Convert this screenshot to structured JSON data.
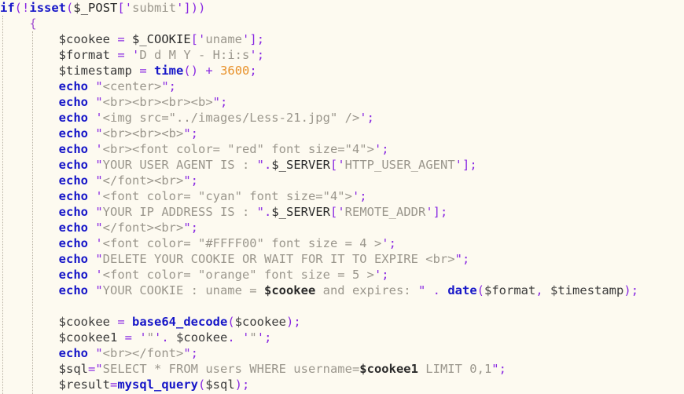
{
  "editor": {
    "language": "PHP",
    "background_color": "#FDFAF0",
    "indent_guide_color": "#b9b2a4",
    "theme_colors": {
      "keyword": "#1616c8",
      "function": "#1616c8",
      "punctuation": "#8a2be2",
      "variable": "#3a3a3a",
      "superglobal": "#2a2a2a",
      "string": "#9a968c",
      "quote": "#8a2be2",
      "number": "#e8912a",
      "brace": "#a24fd0"
    }
  },
  "lines": [
    {
      "id": 1,
      "text": "if(!isset($_POST['submit']))",
      "tokens": [
        {
          "t": "if",
          "c": "kw"
        },
        {
          "t": "(",
          "c": "punc"
        },
        {
          "t": "!",
          "c": "punc"
        },
        {
          "t": "isset",
          "c": "fn"
        },
        {
          "t": "(",
          "c": "punc"
        },
        {
          "t": "$_POST",
          "c": "super"
        },
        {
          "t": "[",
          "c": "punc"
        },
        {
          "t": "'",
          "c": "quote"
        },
        {
          "t": "submit",
          "c": "str"
        },
        {
          "t": "'",
          "c": "quote"
        },
        {
          "t": "]",
          "c": "punc"
        },
        {
          "t": ")",
          "c": "punc"
        },
        {
          "t": ")",
          "c": "punc"
        }
      ]
    },
    {
      "id": 2,
      "text": "    {",
      "tokens": [
        {
          "t": "    ",
          "c": "plain"
        },
        {
          "t": "{",
          "c": "brace"
        }
      ]
    },
    {
      "id": 3,
      "text": "        $cookee = $_COOKIE['uname'];",
      "tokens": [
        {
          "t": "        ",
          "c": "plain"
        },
        {
          "t": "$cookee",
          "c": "var"
        },
        {
          "t": " ",
          "c": "plain"
        },
        {
          "t": "=",
          "c": "punc"
        },
        {
          "t": " ",
          "c": "plain"
        },
        {
          "t": "$_COOKIE",
          "c": "super"
        },
        {
          "t": "[",
          "c": "punc"
        },
        {
          "t": "'",
          "c": "quote"
        },
        {
          "t": "uname",
          "c": "str"
        },
        {
          "t": "'",
          "c": "quote"
        },
        {
          "t": "]",
          "c": "punc"
        },
        {
          "t": ";",
          "c": "punc"
        }
      ]
    },
    {
      "id": 4,
      "text": "        $format = 'D d M Y - H:i:s';",
      "tokens": [
        {
          "t": "        ",
          "c": "plain"
        },
        {
          "t": "$format",
          "c": "var"
        },
        {
          "t": " ",
          "c": "plain"
        },
        {
          "t": "=",
          "c": "punc"
        },
        {
          "t": " ",
          "c": "plain"
        },
        {
          "t": "'",
          "c": "quote"
        },
        {
          "t": "D d M Y - H:i:s",
          "c": "str"
        },
        {
          "t": "'",
          "c": "quote"
        },
        {
          "t": ";",
          "c": "punc"
        }
      ]
    },
    {
      "id": 5,
      "text": "        $timestamp = time() + 3600;",
      "tokens": [
        {
          "t": "        ",
          "c": "plain"
        },
        {
          "t": "$timestamp",
          "c": "var"
        },
        {
          "t": " ",
          "c": "plain"
        },
        {
          "t": "=",
          "c": "punc"
        },
        {
          "t": " ",
          "c": "plain"
        },
        {
          "t": "time",
          "c": "fn"
        },
        {
          "t": "(",
          "c": "punc"
        },
        {
          "t": ")",
          "c": "punc"
        },
        {
          "t": " ",
          "c": "plain"
        },
        {
          "t": "+",
          "c": "punc"
        },
        {
          "t": " ",
          "c": "plain"
        },
        {
          "t": "3600",
          "c": "num"
        },
        {
          "t": ";",
          "c": "punc"
        }
      ]
    },
    {
      "id": 6,
      "text": "        echo \"<center>\";",
      "tokens": [
        {
          "t": "        ",
          "c": "plain"
        },
        {
          "t": "echo",
          "c": "kw"
        },
        {
          "t": " ",
          "c": "plain"
        },
        {
          "t": "\"",
          "c": "quote"
        },
        {
          "t": "<center>",
          "c": "str"
        },
        {
          "t": "\"",
          "c": "quote"
        },
        {
          "t": ";",
          "c": "punc"
        }
      ]
    },
    {
      "id": 7,
      "text": "        echo \"<br><br><br><b>\";",
      "tokens": [
        {
          "t": "        ",
          "c": "plain"
        },
        {
          "t": "echo",
          "c": "kw"
        },
        {
          "t": " ",
          "c": "plain"
        },
        {
          "t": "\"",
          "c": "quote"
        },
        {
          "t": "<br><br><br><b>",
          "c": "str"
        },
        {
          "t": "\"",
          "c": "quote"
        },
        {
          "t": ";",
          "c": "punc"
        }
      ]
    },
    {
      "id": 8,
      "text": "        echo '<img src=\"../images/Less-21.jpg\" />';",
      "tokens": [
        {
          "t": "        ",
          "c": "plain"
        },
        {
          "t": "echo",
          "c": "kw"
        },
        {
          "t": " ",
          "c": "plain"
        },
        {
          "t": "'",
          "c": "quote"
        },
        {
          "t": "<img src=\"../images/Less-21.jpg\" />",
          "c": "str"
        },
        {
          "t": "'",
          "c": "quote"
        },
        {
          "t": ";",
          "c": "punc"
        }
      ]
    },
    {
      "id": 9,
      "text": "        echo \"<br><br><b>\";",
      "tokens": [
        {
          "t": "        ",
          "c": "plain"
        },
        {
          "t": "echo",
          "c": "kw"
        },
        {
          "t": " ",
          "c": "plain"
        },
        {
          "t": "\"",
          "c": "quote"
        },
        {
          "t": "<br><br><b>",
          "c": "str"
        },
        {
          "t": "\"",
          "c": "quote"
        },
        {
          "t": ";",
          "c": "punc"
        }
      ]
    },
    {
      "id": 10,
      "text": "        echo '<br><font color= \"red\" font size=\"4\">';",
      "tokens": [
        {
          "t": "        ",
          "c": "plain"
        },
        {
          "t": "echo",
          "c": "kw"
        },
        {
          "t": " ",
          "c": "plain"
        },
        {
          "t": "'",
          "c": "quote"
        },
        {
          "t": "<br><font color= \"red\" font size=\"4\">",
          "c": "str"
        },
        {
          "t": "'",
          "c": "quote"
        },
        {
          "t": ";",
          "c": "punc"
        }
      ]
    },
    {
      "id": 11,
      "text": "        echo \"YOUR USER AGENT IS : \".$_SERVER['HTTP_USER_AGENT'];",
      "tokens": [
        {
          "t": "        ",
          "c": "plain"
        },
        {
          "t": "echo",
          "c": "kw"
        },
        {
          "t": " ",
          "c": "plain"
        },
        {
          "t": "\"",
          "c": "quote"
        },
        {
          "t": "YOUR USER AGENT IS : ",
          "c": "str"
        },
        {
          "t": "\"",
          "c": "quote"
        },
        {
          "t": ".",
          "c": "punc"
        },
        {
          "t": "$_SERVER",
          "c": "super"
        },
        {
          "t": "[",
          "c": "punc"
        },
        {
          "t": "'",
          "c": "quote"
        },
        {
          "t": "HTTP_USER_AGENT",
          "c": "str"
        },
        {
          "t": "'",
          "c": "quote"
        },
        {
          "t": "]",
          "c": "punc"
        },
        {
          "t": ";",
          "c": "punc"
        }
      ]
    },
    {
      "id": 12,
      "text": "        echo \"</font><br>\";",
      "tokens": [
        {
          "t": "        ",
          "c": "plain"
        },
        {
          "t": "echo",
          "c": "kw"
        },
        {
          "t": " ",
          "c": "plain"
        },
        {
          "t": "\"",
          "c": "quote"
        },
        {
          "t": "</font><br>",
          "c": "str"
        },
        {
          "t": "\"",
          "c": "quote"
        },
        {
          "t": ";",
          "c": "punc"
        }
      ]
    },
    {
      "id": 13,
      "text": "        echo '<font color= \"cyan\" font size=\"4\">';",
      "tokens": [
        {
          "t": "        ",
          "c": "plain"
        },
        {
          "t": "echo",
          "c": "kw"
        },
        {
          "t": " ",
          "c": "plain"
        },
        {
          "t": "'",
          "c": "quote"
        },
        {
          "t": "<font color= \"cyan\" font size=\"4\">",
          "c": "str"
        },
        {
          "t": "'",
          "c": "quote"
        },
        {
          "t": ";",
          "c": "punc"
        }
      ]
    },
    {
      "id": 14,
      "text": "        echo \"YOUR IP ADDRESS IS : \".$_SERVER['REMOTE_ADDR'];",
      "tokens": [
        {
          "t": "        ",
          "c": "plain"
        },
        {
          "t": "echo",
          "c": "kw"
        },
        {
          "t": " ",
          "c": "plain"
        },
        {
          "t": "\"",
          "c": "quote"
        },
        {
          "t": "YOUR IP ADDRESS IS : ",
          "c": "str"
        },
        {
          "t": "\"",
          "c": "quote"
        },
        {
          "t": ".",
          "c": "punc"
        },
        {
          "t": "$_SERVER",
          "c": "super"
        },
        {
          "t": "[",
          "c": "punc"
        },
        {
          "t": "'",
          "c": "quote"
        },
        {
          "t": "REMOTE_ADDR",
          "c": "str"
        },
        {
          "t": "'",
          "c": "quote"
        },
        {
          "t": "]",
          "c": "punc"
        },
        {
          "t": ";",
          "c": "punc"
        }
      ]
    },
    {
      "id": 15,
      "text": "        echo \"</font><br>\";",
      "tokens": [
        {
          "t": "        ",
          "c": "plain"
        },
        {
          "t": "echo",
          "c": "kw"
        },
        {
          "t": " ",
          "c": "plain"
        },
        {
          "t": "\"",
          "c": "quote"
        },
        {
          "t": "</font><br>",
          "c": "str"
        },
        {
          "t": "\"",
          "c": "quote"
        },
        {
          "t": ";",
          "c": "punc"
        }
      ]
    },
    {
      "id": 16,
      "text": "        echo '<font color= \"#FFFF00\" font size = 4 >';",
      "tokens": [
        {
          "t": "        ",
          "c": "plain"
        },
        {
          "t": "echo",
          "c": "kw"
        },
        {
          "t": " ",
          "c": "plain"
        },
        {
          "t": "'",
          "c": "quote"
        },
        {
          "t": "<font color= \"#FFFF00\" font size = 4 >",
          "c": "str"
        },
        {
          "t": "'",
          "c": "quote"
        },
        {
          "t": ";",
          "c": "punc"
        }
      ]
    },
    {
      "id": 17,
      "text": "        echo \"DELETE YOUR COOKIE OR WAIT FOR IT TO EXPIRE <br>\";",
      "tokens": [
        {
          "t": "        ",
          "c": "plain"
        },
        {
          "t": "echo",
          "c": "kw"
        },
        {
          "t": " ",
          "c": "plain"
        },
        {
          "t": "\"",
          "c": "quote"
        },
        {
          "t": "DELETE YOUR COOKIE OR WAIT FOR IT TO EXPIRE <br>",
          "c": "str"
        },
        {
          "t": "\"",
          "c": "quote"
        },
        {
          "t": ";",
          "c": "punc"
        }
      ]
    },
    {
      "id": 18,
      "text": "        echo '<font color= \"orange\" font size = 5 >';",
      "tokens": [
        {
          "t": "        ",
          "c": "plain"
        },
        {
          "t": "echo",
          "c": "kw"
        },
        {
          "t": " ",
          "c": "plain"
        },
        {
          "t": "'",
          "c": "quote"
        },
        {
          "t": "<font color= \"orange\" font size = 5 >",
          "c": "str"
        },
        {
          "t": "'",
          "c": "quote"
        },
        {
          "t": ";",
          "c": "punc"
        }
      ]
    },
    {
      "id": 19,
      "text": "        echo \"YOUR COOKIE : uname = $cookee and expires: \" . date($format, $timestamp);",
      "tokens": [
        {
          "t": "        ",
          "c": "plain"
        },
        {
          "t": "echo",
          "c": "kw"
        },
        {
          "t": " ",
          "c": "plain"
        },
        {
          "t": "\"",
          "c": "quote"
        },
        {
          "t": "YOUR COOKIE : uname = ",
          "c": "str"
        },
        {
          "t": "$cookee",
          "c": "interp"
        },
        {
          "t": " and expires: ",
          "c": "str"
        },
        {
          "t": "\"",
          "c": "quote"
        },
        {
          "t": " ",
          "c": "plain"
        },
        {
          "t": ".",
          "c": "punc"
        },
        {
          "t": " ",
          "c": "plain"
        },
        {
          "t": "date",
          "c": "fn"
        },
        {
          "t": "(",
          "c": "punc"
        },
        {
          "t": "$format",
          "c": "var"
        },
        {
          "t": ",",
          "c": "punc"
        },
        {
          "t": " ",
          "c": "plain"
        },
        {
          "t": "$timestamp",
          "c": "var"
        },
        {
          "t": ")",
          "c": "punc"
        },
        {
          "t": ";",
          "c": "punc"
        }
      ]
    },
    {
      "id": 20,
      "text": "",
      "tokens": []
    },
    {
      "id": 21,
      "text": "        $cookee = base64_decode($cookee);",
      "tokens": [
        {
          "t": "        ",
          "c": "plain"
        },
        {
          "t": "$cookee",
          "c": "var"
        },
        {
          "t": " ",
          "c": "plain"
        },
        {
          "t": "=",
          "c": "punc"
        },
        {
          "t": " ",
          "c": "plain"
        },
        {
          "t": "base64_decode",
          "c": "fn"
        },
        {
          "t": "(",
          "c": "punc"
        },
        {
          "t": "$cookee",
          "c": "var"
        },
        {
          "t": ")",
          "c": "punc"
        },
        {
          "t": ";",
          "c": "punc"
        }
      ]
    },
    {
      "id": 22,
      "text": "        $cookee1 = '\"'. $cookee. '\"';",
      "tokens": [
        {
          "t": "        ",
          "c": "plain"
        },
        {
          "t": "$cookee1",
          "c": "var"
        },
        {
          "t": " ",
          "c": "plain"
        },
        {
          "t": "=",
          "c": "punc"
        },
        {
          "t": " ",
          "c": "plain"
        },
        {
          "t": "'",
          "c": "quote"
        },
        {
          "t": "\"",
          "c": "str"
        },
        {
          "t": "'",
          "c": "quote"
        },
        {
          "t": ".",
          "c": "punc"
        },
        {
          "t": " ",
          "c": "plain"
        },
        {
          "t": "$cookee",
          "c": "var"
        },
        {
          "t": ".",
          "c": "punc"
        },
        {
          "t": " ",
          "c": "plain"
        },
        {
          "t": "'",
          "c": "quote"
        },
        {
          "t": "\"",
          "c": "str"
        },
        {
          "t": "'",
          "c": "quote"
        },
        {
          "t": ";",
          "c": "punc"
        }
      ]
    },
    {
      "id": 23,
      "text": "        echo \"<br></font>\";",
      "tokens": [
        {
          "t": "        ",
          "c": "plain"
        },
        {
          "t": "echo",
          "c": "kw"
        },
        {
          "t": " ",
          "c": "plain"
        },
        {
          "t": "\"",
          "c": "quote"
        },
        {
          "t": "<br></font>",
          "c": "str"
        },
        {
          "t": "\"",
          "c": "quote"
        },
        {
          "t": ";",
          "c": "punc"
        }
      ]
    },
    {
      "id": 24,
      "text": "        $sql=\"SELECT * FROM users WHERE username=$cookee1 LIMIT 0,1\";",
      "tokens": [
        {
          "t": "        ",
          "c": "plain"
        },
        {
          "t": "$sql",
          "c": "var"
        },
        {
          "t": "=",
          "c": "punc"
        },
        {
          "t": "\"",
          "c": "quote"
        },
        {
          "t": "SELECT * FROM users WHERE username=",
          "c": "str"
        },
        {
          "t": "$cookee1",
          "c": "interp"
        },
        {
          "t": " LIMIT 0,1",
          "c": "str"
        },
        {
          "t": "\"",
          "c": "quote"
        },
        {
          "t": ";",
          "c": "punc"
        }
      ]
    },
    {
      "id": 25,
      "text": "        $result=mysql_query($sql);",
      "tokens": [
        {
          "t": "        ",
          "c": "plain"
        },
        {
          "t": "$result",
          "c": "var"
        },
        {
          "t": "=",
          "c": "punc"
        },
        {
          "t": "mysql_query",
          "c": "fn"
        },
        {
          "t": "(",
          "c": "punc"
        },
        {
          "t": "$sql",
          "c": "var"
        },
        {
          "t": ")",
          "c": "punc"
        },
        {
          "t": ";",
          "c": "punc"
        }
      ]
    }
  ]
}
